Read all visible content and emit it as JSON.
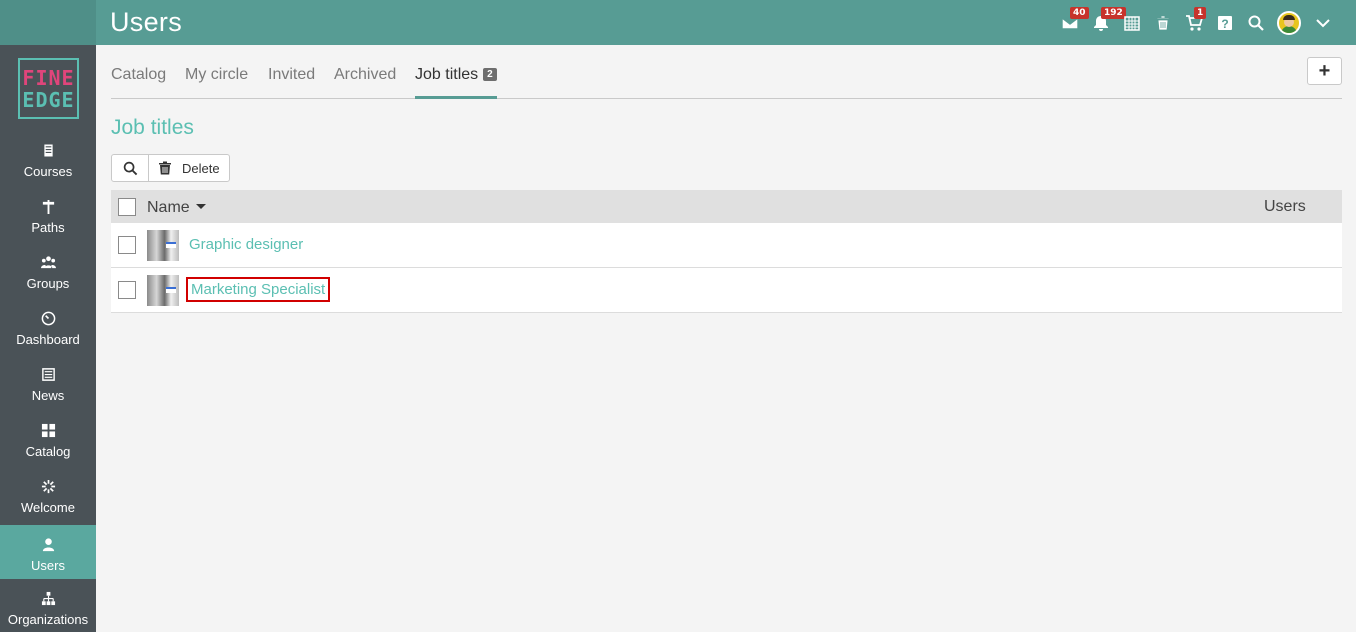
{
  "header": {
    "title": "Users",
    "icons": [
      {
        "name": "mail-icon",
        "badge": "40"
      },
      {
        "name": "bell-icon",
        "badge": "192"
      },
      {
        "name": "calendar-icon",
        "badge": ""
      },
      {
        "name": "trash-icon",
        "badge": ""
      },
      {
        "name": "cart-icon",
        "badge": "1"
      },
      {
        "name": "help-icon",
        "badge": ""
      },
      {
        "name": "search-icon",
        "badge": ""
      }
    ]
  },
  "logo": {
    "line1": "FINE",
    "line2": "EDGE"
  },
  "sidebar": {
    "items": [
      {
        "label": "Courses",
        "icon": "book-icon"
      },
      {
        "label": "Paths",
        "icon": "signpost-icon"
      },
      {
        "label": "Groups",
        "icon": "group-icon"
      },
      {
        "label": "Dashboard",
        "icon": "gauge-icon"
      },
      {
        "label": "News",
        "icon": "newspaper-icon"
      },
      {
        "label": "Catalog",
        "icon": "grid-icon"
      },
      {
        "label": "Welcome",
        "icon": "spinner-icon"
      },
      {
        "label": "Users",
        "icon": "user-icon",
        "active": true
      },
      {
        "label": "Organizations",
        "icon": "org-chart-icon"
      }
    ]
  },
  "tabs": [
    {
      "label": "Catalog"
    },
    {
      "label": "My circle"
    },
    {
      "label": "Invited"
    },
    {
      "label": "Archived"
    },
    {
      "label": "Job titles",
      "count": "2",
      "active": true
    }
  ],
  "add_button": "+",
  "section_title": "Job titles",
  "toolbar": {
    "delete_label": "Delete"
  },
  "table": {
    "columns": {
      "name": "Name",
      "users": "Users"
    },
    "rows": [
      {
        "name": "Graphic designer"
      },
      {
        "name": "Marketing Specialist",
        "highlighted": true
      }
    ]
  },
  "colors": {
    "header": "#579c94",
    "sidebar": "#4a5257",
    "accent": "#5bbfb2",
    "badge": "#c7332b",
    "highlight": "#d10000"
  }
}
